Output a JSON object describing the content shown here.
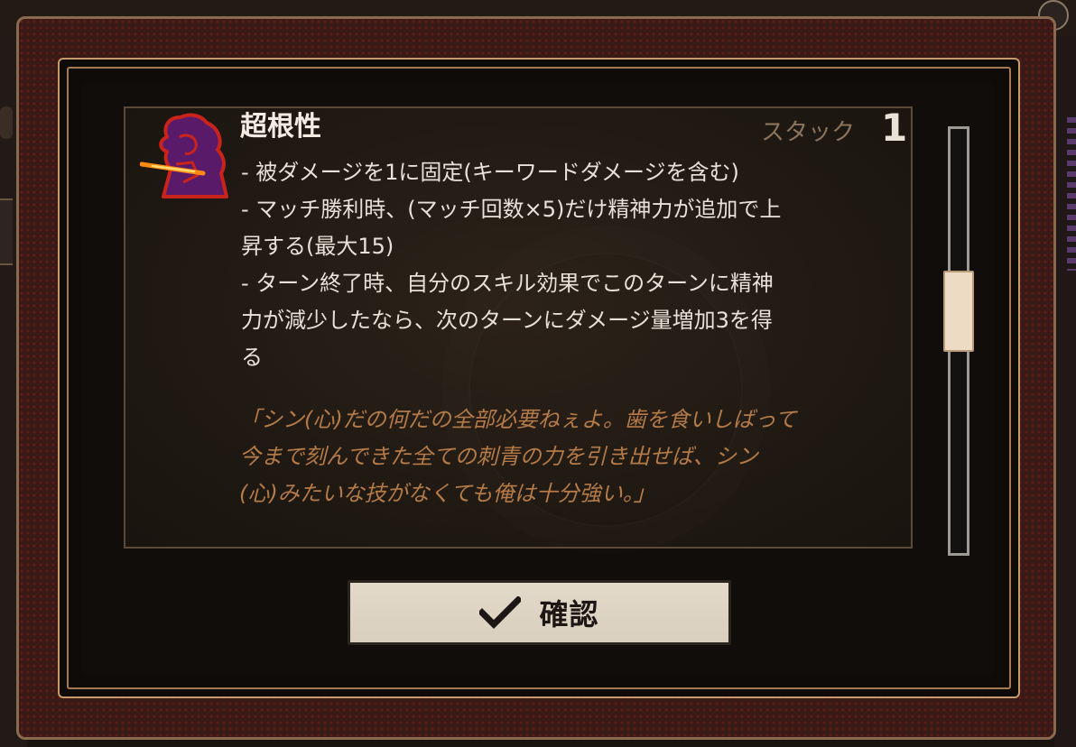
{
  "dialog": {
    "title": "超根性",
    "stack_label": "スタック",
    "stack_value": "1",
    "description_lines": [
      "- 被ダメージを1に固定(キーワードダメージを含む)",
      "- マッチ勝利時、(マッチ回数×5)だけ精神力が追加で上",
      "昇する(最大15)",
      "- ターン終了時、自分のスキル効果でこのターンに精神",
      "力が減少したなら、次のターンにダメージ量増加3を得",
      "る"
    ],
    "flavor_lines": [
      "「シン(心)だの何だの全部必要ねぇよ。歯を食いしばって",
      "今まで刻んできた全ての刺青の力を引き出せば、シン",
      "(心)みたいな技がなくても俺は十分強い。」"
    ],
    "confirm_label": "確認",
    "icon": "character-silhouette-icon"
  },
  "colors": {
    "frame_border": "#c79a6c",
    "title": "#f2ece2",
    "flavor_text": "#b47a48",
    "icon_red": "#c8241c",
    "icon_flame": "#ffb020"
  }
}
